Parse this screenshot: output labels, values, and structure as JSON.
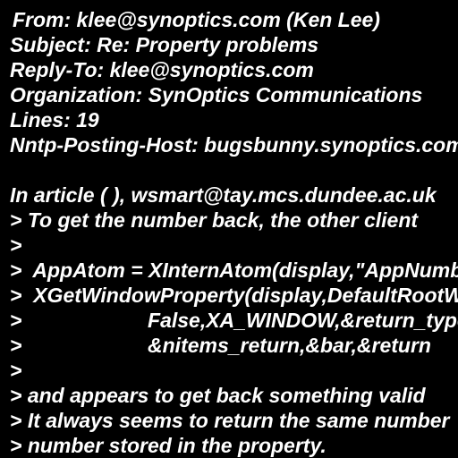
{
  "colors": {
    "background": "#000000",
    "text": "#ffffff"
  },
  "header": {
    "from": "From: klee@synoptics.com (Ken Lee)",
    "subject": "Subject: Re: Property problems",
    "reply_to": "Reply-To: klee@synoptics.com",
    "organization": "Organization: SynOptics Communications",
    "lines": "Lines: 19",
    "nntp_posting_host": "Nntp-Posting-Host: bugsbunny.synoptics.com"
  },
  "body": {
    "attribution": "In article ( ), wsmart@tay.mcs.dundee.ac.uk",
    "quoted": [
      "> To get the number back, the other client",
      ">",
      ">  AppAtom = XInternAtom(display,\"AppNumber\"",
      ">  XGetWindowProperty(display,DefaultRootWindow",
      ">                      False,XA_WINDOW,&return_type",
      ">                      &nitems_return,&bar,&return",
      ">",
      "> and appears to get back something valid",
      "> It always seems to return the same number",
      "> number stored in the property."
    ]
  }
}
